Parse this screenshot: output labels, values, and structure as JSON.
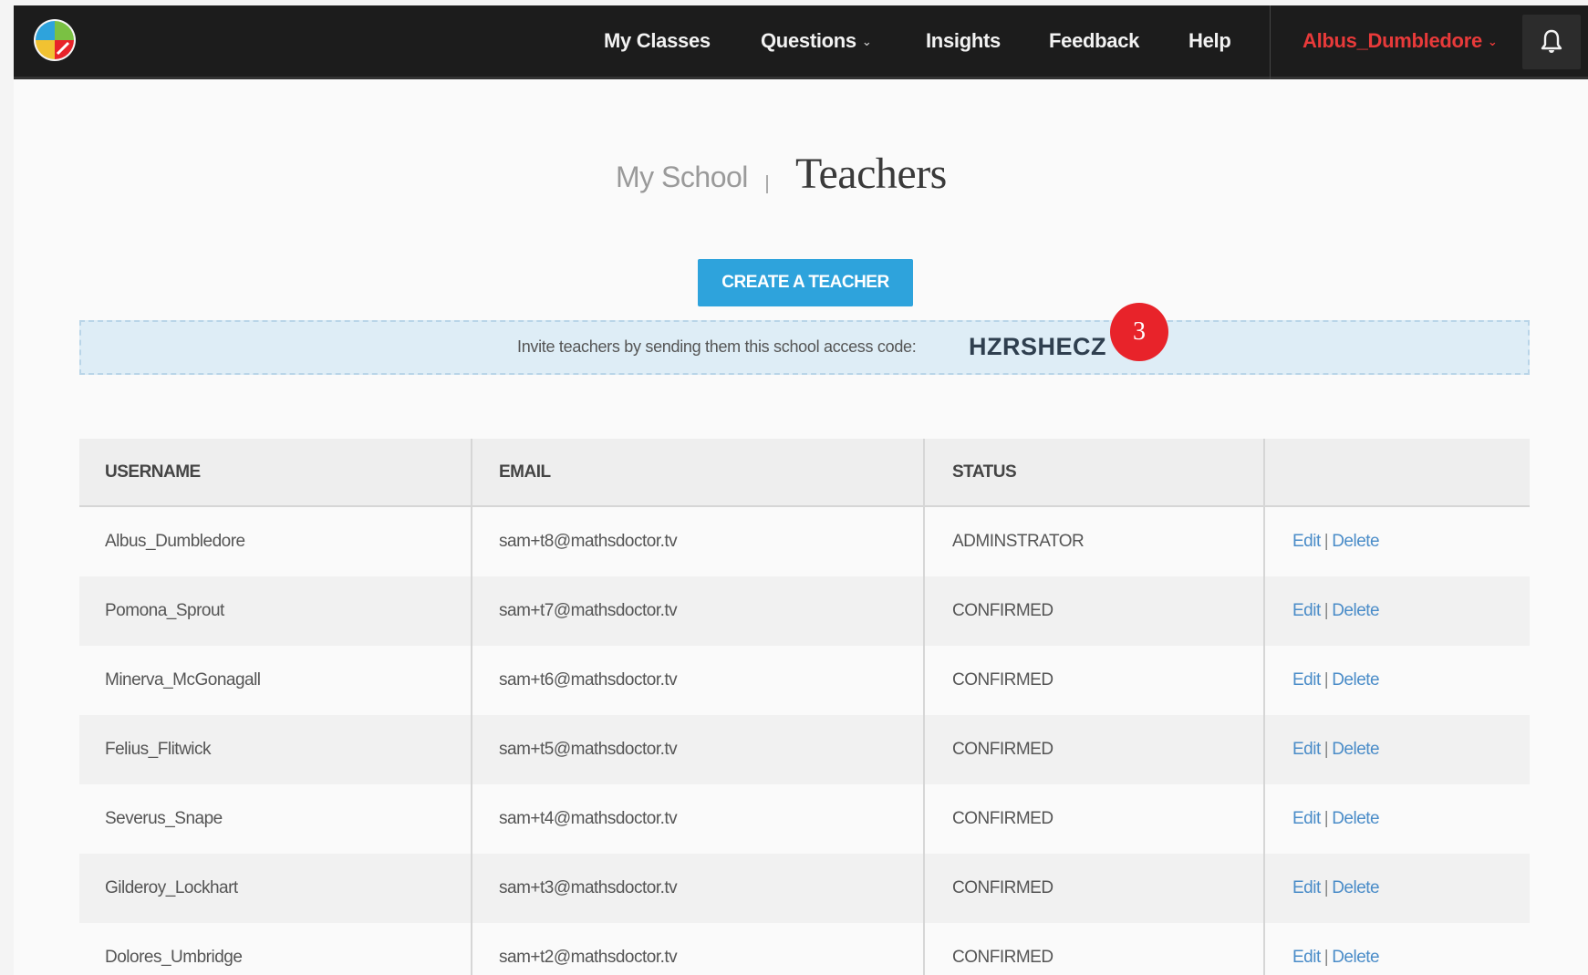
{
  "navbar": {
    "logo_name": "pie-logo-icon",
    "links": [
      {
        "label": "My Classes",
        "has_caret": false
      },
      {
        "label": "Questions",
        "has_caret": true
      },
      {
        "label": "Insights",
        "has_caret": false
      },
      {
        "label": "Feedback",
        "has_caret": false
      },
      {
        "label": "Help",
        "has_caret": false
      }
    ],
    "user": "Albus_Dumbledore",
    "caret_glyph": "⌄",
    "bell_icon": "bell-icon",
    "accent_color": "#e83a3a"
  },
  "heading": {
    "breadcrumb": "My School",
    "title": "Teachers"
  },
  "create_button": {
    "label": "CREATE A TEACHER",
    "color": "#2ea3dc"
  },
  "invite": {
    "text": "Invite teachers by sending them this school access code:",
    "code": "HZRSHECZ"
  },
  "step_badge": "3",
  "table": {
    "headers": [
      "USERNAME",
      "EMAIL",
      "STATUS",
      ""
    ],
    "edit_label": "Edit",
    "separator": "|",
    "delete_label": "Delete",
    "rows": [
      {
        "username": "Albus_Dumbledore",
        "email": "sam+t8@mathsdoctor.tv",
        "status": "ADMINSTRATOR"
      },
      {
        "username": "Pomona_Sprout",
        "email": "sam+t7@mathsdoctor.tv",
        "status": "CONFIRMED"
      },
      {
        "username": "Minerva_McGonagall",
        "email": "sam+t6@mathsdoctor.tv",
        "status": "CONFIRMED"
      },
      {
        "username": "Felius_Flitwick",
        "email": "sam+t5@mathsdoctor.tv",
        "status": "CONFIRMED"
      },
      {
        "username": "Severus_Snape",
        "email": "sam+t4@mathsdoctor.tv",
        "status": "CONFIRMED"
      },
      {
        "username": "Gilderoy_Lockhart",
        "email": "sam+t3@mathsdoctor.tv",
        "status": "CONFIRMED"
      },
      {
        "username": "Dolores_Umbridge",
        "email": "sam+t2@mathsdoctor.tv",
        "status": "CONFIRMED"
      }
    ]
  }
}
